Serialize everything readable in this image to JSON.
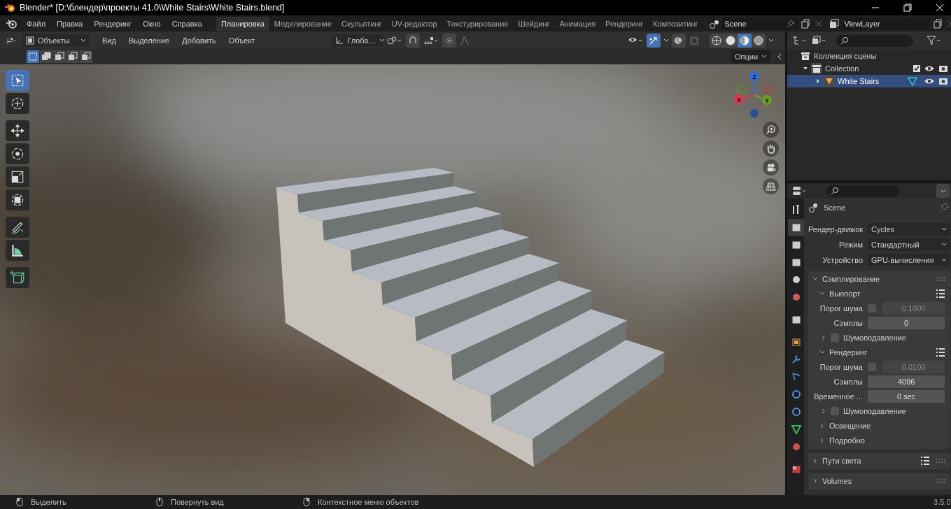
{
  "window": {
    "title": "Blender* [D:\\блендер\\проекты 41.0\\White Stairs\\White Stairs.blend]"
  },
  "menu": [
    "Файл",
    "Правка",
    "Рендеринг",
    "Окно",
    "Справка"
  ],
  "workspaces": [
    {
      "label": "Планировка",
      "selected": true
    },
    {
      "label": "Моделирование",
      "selected": false
    },
    {
      "label": "Скульптинг",
      "selected": false
    },
    {
      "label": "UV-редактор",
      "selected": false
    },
    {
      "label": "Текстурирование",
      "selected": false
    },
    {
      "label": "Шейдинг",
      "selected": false
    },
    {
      "label": "Анимация",
      "selected": false
    },
    {
      "label": "Рендеринг",
      "selected": false
    },
    {
      "label": "Композитинг",
      "selected": false
    }
  ],
  "scene": {
    "name": "Scene"
  },
  "view_layer": {
    "name": "ViewLayer"
  },
  "viewport": {
    "mode": "Объекты",
    "menus": [
      "Вид",
      "Выделение",
      "Добавить",
      "Объект"
    ],
    "orientation": "Глоба…",
    "gizmo_toggle": {
      "on": true
    },
    "shading": [
      {
        "selected": false
      },
      {
        "selected": false
      },
      {
        "selected": true
      },
      {
        "selected": false
      }
    ],
    "select_modes": [
      {
        "selected": true
      },
      {
        "selected": false
      },
      {
        "selected": false
      },
      {
        "selected": false
      },
      {
        "selected": false
      }
    ],
    "options": "Опции",
    "tools": [
      {
        "selected": true
      },
      {
        "selected": false
      },
      {
        "selected": false
      },
      {
        "selected": false
      },
      {
        "selected": false
      },
      {
        "selected": false
      },
      {
        "selected": false
      },
      {
        "selected": false
      },
      {
        "selected": false
      }
    ],
    "axes": [
      {
        "label": "Z"
      },
      {
        "label": "X"
      },
      {
        "label": "Y"
      }
    ]
  },
  "outliner": {
    "tree": [
      {
        "label": "Коллекция сцены",
        "selected": false,
        "children": [
          {
            "label": "Collection",
            "expanded": true,
            "checked": true,
            "selected": false,
            "children": [
              {
                "label": "White Stairs",
                "expanded": false,
                "selected": true
              }
            ]
          }
        ]
      }
    ]
  },
  "properties": {
    "tabs": [
      {
        "selected": false
      },
      {
        "selected": true
      },
      {
        "selected": false
      },
      {
        "selected": false
      },
      {
        "selected": false
      },
      {
        "selected": false
      },
      {
        "selected": false
      },
      {
        "selected": false
      },
      {
        "selected": false
      },
      {
        "selected": false
      },
      {
        "selected": false
      },
      {
        "selected": false
      },
      {
        "selected": false
      },
      {
        "selected": false
      },
      {
        "selected": false
      }
    ],
    "context": "Scene",
    "fields": [
      {
        "label": "Рендер-движок",
        "value": "Cycles"
      },
      {
        "label": "Режим",
        "value": "Стандартный"
      },
      {
        "label": "Устройство",
        "value": "GPU-вычисления"
      }
    ],
    "panels": [
      {
        "label": "Сэмплирование",
        "expanded": true,
        "children": [
          {
            "label": "Вьюпорт",
            "expanded": true,
            "presets": true,
            "rows": [
              {
                "kind": "toggle-number",
                "label": "Порог шума",
                "checked": false,
                "value": "0.1000"
              },
              {
                "kind": "number",
                "label": "Сэмплы",
                "value": "0"
              }
            ],
            "subpanels": [
              {
                "label": "Шумоподавление",
                "expanded": false,
                "checked": false
              }
            ]
          },
          {
            "label": "Рендеринг",
            "expanded": true,
            "presets": true,
            "rows": [
              {
                "kind": "toggle-number",
                "label": "Порог шума",
                "checked": false,
                "value": "0.0100"
              },
              {
                "kind": "number",
                "label": "Сэмплы",
                "value": "4096"
              },
              {
                "kind": "number",
                "label": "Временное ...",
                "value": "0 sec"
              }
            ],
            "subpanels": [
              {
                "label": "Шумоподавление",
                "expanded": false,
                "checked": false
              }
            ]
          },
          {
            "label": "Освещение",
            "expanded": false
          },
          {
            "label": "Подробно",
            "expanded": false
          }
        ]
      },
      {
        "label": "Пути света",
        "expanded": false,
        "presets": true
      },
      {
        "label": "Volumes",
        "expanded": false
      }
    ]
  },
  "status_bar": {
    "hints": [
      {
        "label": "Выделить"
      },
      {
        "label": "Повернуть вид"
      },
      {
        "label": "Контекстное меню объектов"
      }
    ],
    "version": "3.5.0"
  }
}
